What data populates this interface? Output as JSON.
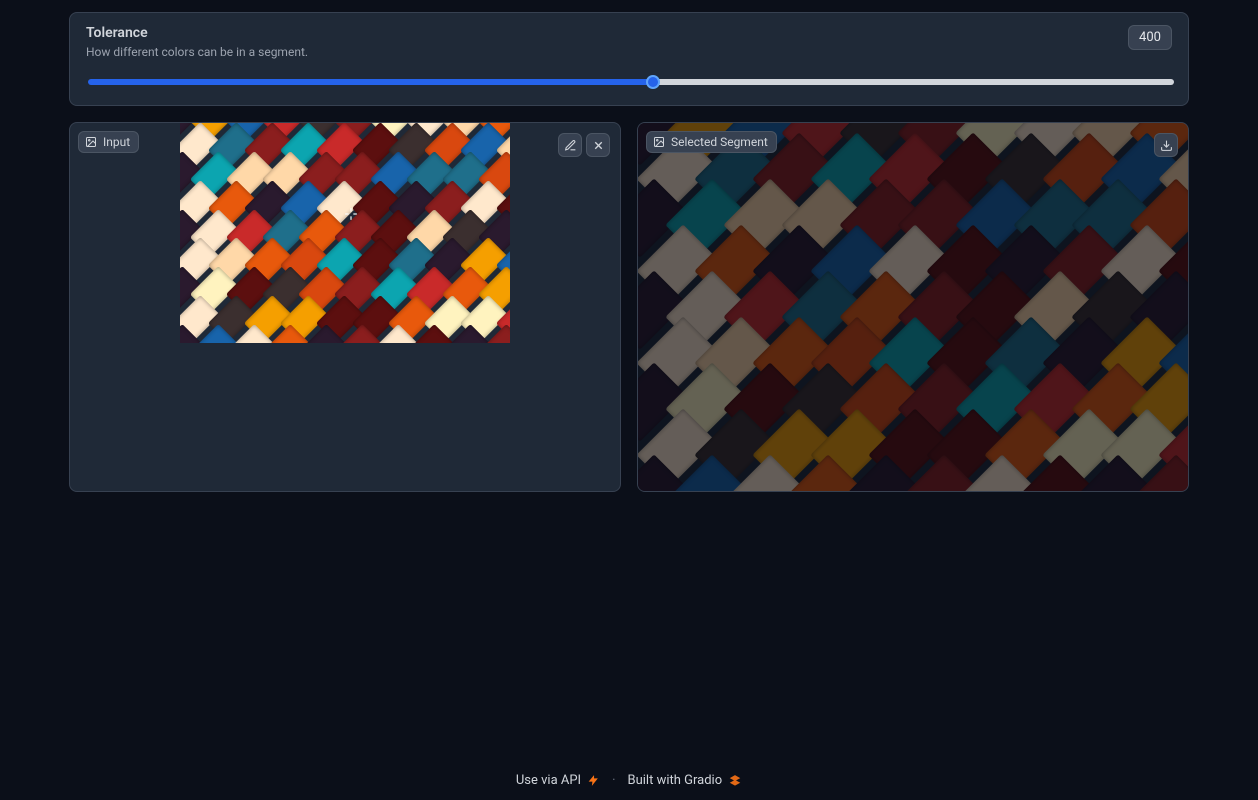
{
  "tolerance": {
    "label": "Tolerance",
    "description": "How different colors can be in a segment.",
    "value": "400"
  },
  "input_panel": {
    "label": "Input"
  },
  "output_panel": {
    "label": "Selected Segment"
  },
  "footer": {
    "api_text": "Use via API",
    "separator": "·",
    "built_text": "Built with Gradio"
  },
  "colors": {
    "palette": [
      "#2a1a2e",
      "#8b1e1e",
      "#d9480f",
      "#f59f00",
      "#fff3bf",
      "#0ca5b0",
      "#1864ab",
      "#ffe8cc",
      "#5c0f0f",
      "#c92a2a",
      "#ffd8a8",
      "#1f6f8b",
      "#3b2f2f",
      "#e8590c"
    ]
  }
}
